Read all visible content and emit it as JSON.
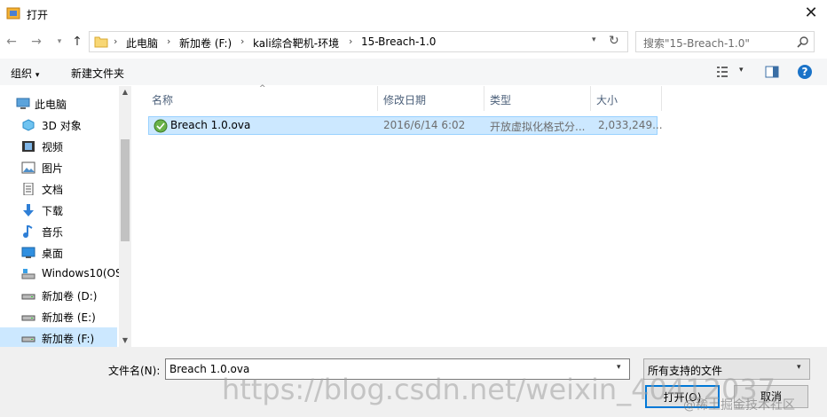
{
  "window": {
    "title": "打开"
  },
  "address": {
    "crumbs": [
      "此电脑",
      "新加卷 (F:)",
      "kali综合靶机-环境",
      "15-Breach-1.0"
    ],
    "search_placeholder": "搜索\"15-Breach-1.0\""
  },
  "toolbar": {
    "organize": "组织",
    "new_folder": "新建文件夹"
  },
  "sidebar": {
    "items": [
      {
        "label": "此电脑",
        "icon": "computer-icon"
      },
      {
        "label": "3D 对象",
        "icon": "cube-3d-icon"
      },
      {
        "label": "视频",
        "icon": "video-icon"
      },
      {
        "label": "图片",
        "icon": "picture-icon"
      },
      {
        "label": "文档",
        "icon": "document-icon"
      },
      {
        "label": "下载",
        "icon": "download-icon"
      },
      {
        "label": "音乐",
        "icon": "music-icon"
      },
      {
        "label": "桌面",
        "icon": "desktop-icon"
      },
      {
        "label": "Windows10(OS",
        "icon": "drive-os-icon"
      },
      {
        "label": "新加卷 (D:)",
        "icon": "drive-icon"
      },
      {
        "label": "新加卷 (E:)",
        "icon": "drive-icon"
      },
      {
        "label": "新加卷 (F:)",
        "icon": "drive-icon",
        "selected": true
      }
    ]
  },
  "columns": {
    "name": "名称",
    "modified": "修改日期",
    "type": "类型",
    "size": "大小"
  },
  "files": [
    {
      "name": "Breach 1.0.ova",
      "modified": "2016/6/14 6:02",
      "type": "开放虚拟化格式分...",
      "size": "2,033,249..."
    }
  ],
  "bottom": {
    "filename_label": "文件名(N):",
    "filename_value": "Breach 1.0.ova",
    "filetype_value": "所有支持的文件",
    "open_button": "打开(O)",
    "cancel_button": "取消"
  },
  "watermark": "https://blog.csdn.net/weixin_40412037",
  "watermark2": "@稀土掘金技术社区"
}
